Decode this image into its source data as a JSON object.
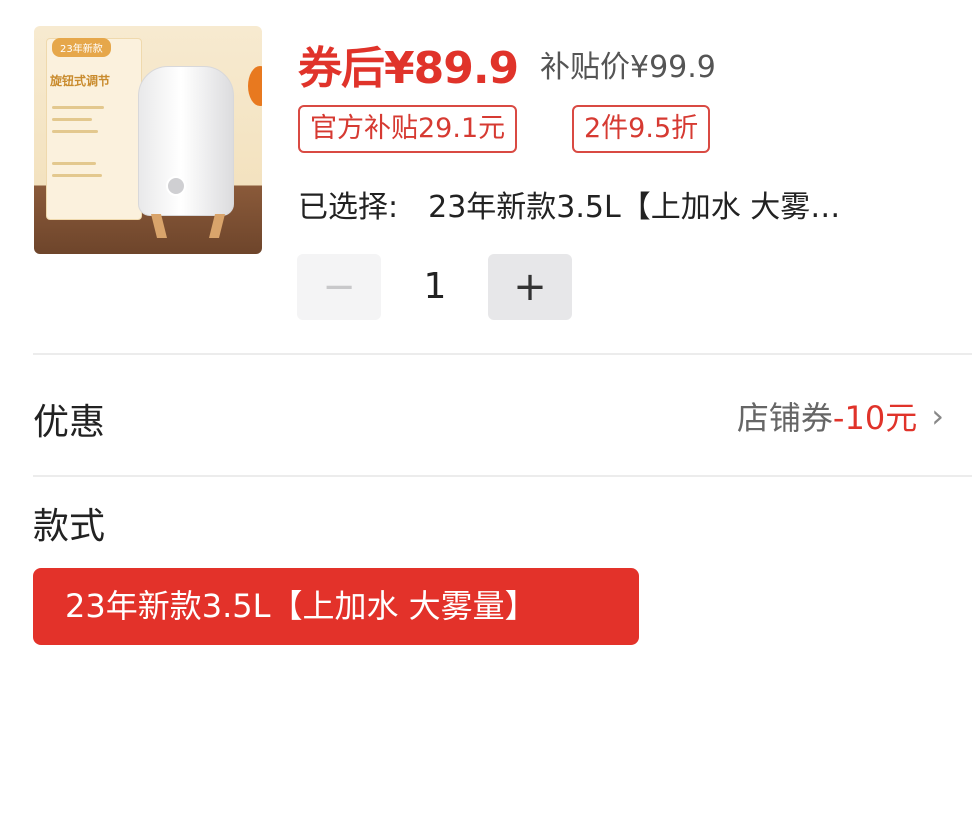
{
  "product": {
    "thumb_tag": "23年新款",
    "thumb_title": "旋钮式调节",
    "price_after_coupon": "券后¥89.9",
    "subsidy_price": "补贴价¥99.9",
    "badges": [
      "官方补贴29.1元",
      "2件9.5折"
    ],
    "selected_label": "已选择:",
    "selected_value": "23年新款3.5L【上加水 大雾…"
  },
  "quantity": {
    "minus_icon": "−",
    "plus_icon": "+",
    "value": "1"
  },
  "discount": {
    "label": "优惠",
    "coupon_text": "店铺券",
    "coupon_amount": "-10元",
    "chevron": "›"
  },
  "style": {
    "label": "款式",
    "option": "23年新款3.5L【上加水 大雾量】"
  },
  "colors": {
    "accent": "#e3322a",
    "badge_border": "#d94a43"
  }
}
